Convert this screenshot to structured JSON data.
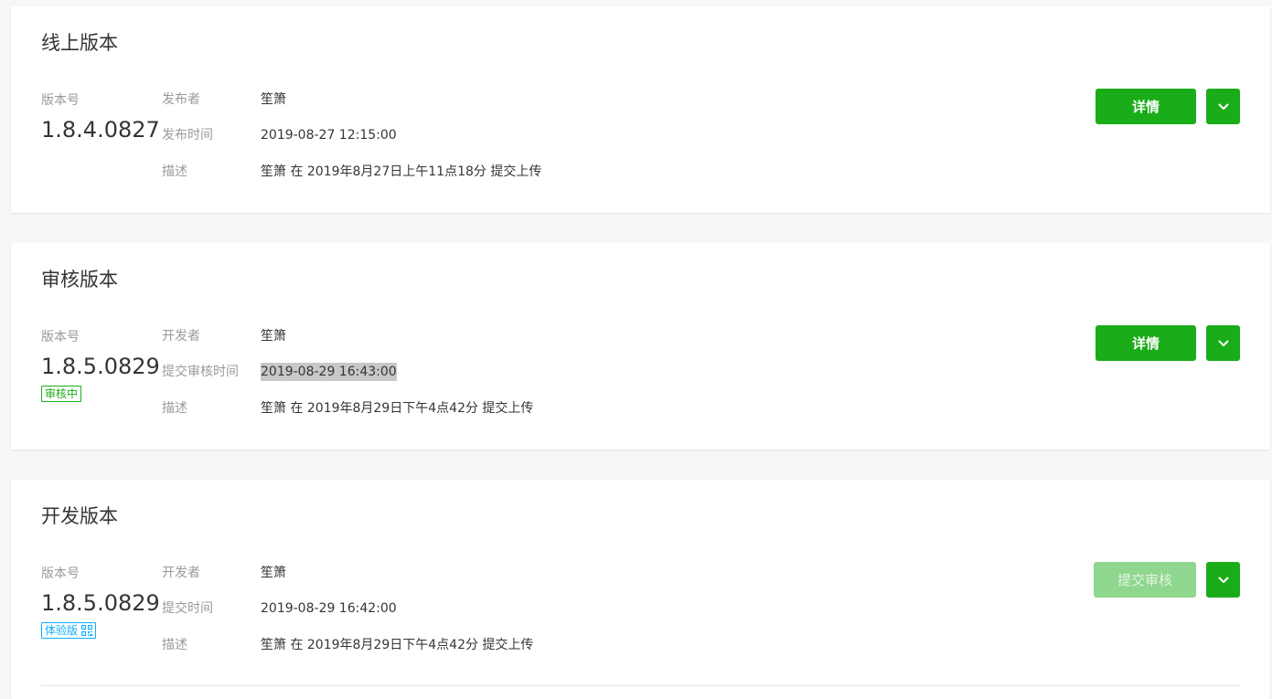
{
  "colors": {
    "page_bg": "#f6f7f9",
    "card_bg": "#ffffff",
    "accent_green": "#1aad19",
    "disabled_green": "#8fd68e",
    "tag_blue": "#10aeff",
    "label_gray": "#9a9a9a",
    "text_dark": "#353535"
  },
  "online": {
    "title": "线上版本",
    "version_label": "版本号",
    "version": "1.8.4.0827",
    "fields": [
      {
        "key": "发布者",
        "value": "笙箫"
      },
      {
        "key": "发布时间",
        "value": "2019-08-27 12:15:00"
      },
      {
        "key": "描述",
        "value": "笙箫 在 2019年8月27日上午11点18分 提交上传"
      }
    ],
    "primary_button": "详情",
    "dropdown_icon": "chevron-down-icon"
  },
  "review": {
    "title": "审核版本",
    "version_label": "版本号",
    "version": "1.8.5.0829",
    "status_badge": "审核中",
    "fields": [
      {
        "key": "开发者",
        "value": "笙箫"
      },
      {
        "key": "提交审核时间",
        "value": "2019-08-29 16:43:00"
      },
      {
        "key": "描述",
        "value": "笙箫 在 2019年8月29日下午4点42分 提交上传"
      }
    ],
    "primary_button": "详情",
    "dropdown_icon": "chevron-down-icon"
  },
  "dev": {
    "title": "开发版本",
    "version_label": "版本号",
    "version": "1.8.5.0829",
    "status_badge": "体验版",
    "badge_icon": "qr-code-icon",
    "fields": [
      {
        "key": "开发者",
        "value": "笙箫"
      },
      {
        "key": "提交时间",
        "value": "2019-08-29 16:42:00"
      },
      {
        "key": "描述",
        "value": "笙箫 在 2019年8月29日下午4点42分 提交上传"
      }
    ],
    "primary_button": "提交审核",
    "primary_button_disabled": true,
    "dropdown_icon": "chevron-down-icon"
  }
}
